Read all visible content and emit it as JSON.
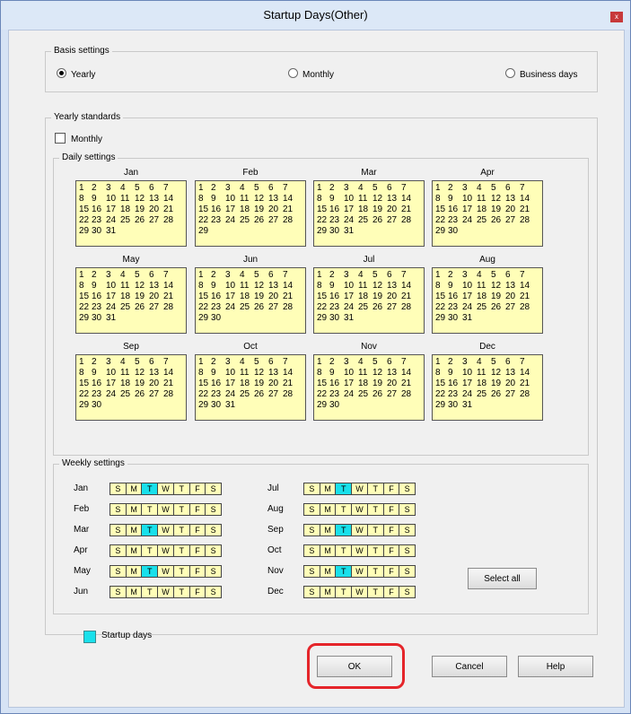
{
  "window": {
    "title": "Startup Days(Other)",
    "close_glyph": "x"
  },
  "basis": {
    "label": "Basis settings",
    "options": [
      {
        "label": "Yearly",
        "selected": true
      },
      {
        "label": "Monthly",
        "selected": false
      },
      {
        "label": "Business days",
        "selected": false
      }
    ]
  },
  "yearly": {
    "label": "Yearly standards",
    "monthly_checkbox": "Monthly",
    "daily_label": "Daily settings",
    "months": [
      {
        "name": "Jan",
        "rows": [
          [
            "1",
            "2",
            "3",
            "4",
            "5",
            "6",
            "7"
          ],
          [
            "8",
            "9",
            "10",
            "11",
            "12",
            "13",
            "14"
          ],
          [
            "15",
            "16",
            "17",
            "18",
            "19",
            "20",
            "21"
          ],
          [
            "22",
            "23",
            "24",
            "25",
            "26",
            "27",
            "28"
          ],
          [
            "29",
            "30",
            "31"
          ]
        ]
      },
      {
        "name": "Feb",
        "rows": [
          [
            "1",
            "2",
            "3",
            "4",
            "5",
            "6",
            "7"
          ],
          [
            "8",
            "9",
            "10",
            "11",
            "12",
            "13",
            "14"
          ],
          [
            "15",
            "16",
            "17",
            "18",
            "19",
            "20",
            "21"
          ],
          [
            "22",
            "23",
            "24",
            "25",
            "26",
            "27",
            "28"
          ],
          [
            "29"
          ]
        ]
      },
      {
        "name": "Mar",
        "rows": [
          [
            "1",
            "2",
            "3",
            "4",
            "5",
            "6",
            "7"
          ],
          [
            "8",
            "9",
            "10",
            "11",
            "12",
            "13",
            "14"
          ],
          [
            "15",
            "16",
            "17",
            "18",
            "19",
            "20",
            "21"
          ],
          [
            "22",
            "23",
            "24",
            "25",
            "26",
            "27",
            "28"
          ],
          [
            "29",
            "30",
            "31"
          ]
        ]
      },
      {
        "name": "Apr",
        "rows": [
          [
            "1",
            "2",
            "3",
            "4",
            "5",
            "6",
            "7"
          ],
          [
            "8",
            "9",
            "10",
            "11",
            "12",
            "13",
            "14"
          ],
          [
            "15",
            "16",
            "17",
            "18",
            "19",
            "20",
            "21"
          ],
          [
            "22",
            "23",
            "24",
            "25",
            "26",
            "27",
            "28"
          ],
          [
            "29",
            "30"
          ]
        ]
      },
      {
        "name": "May",
        "rows": [
          [
            "1",
            "2",
            "3",
            "4",
            "5",
            "6",
            "7"
          ],
          [
            "8",
            "9",
            "10",
            "11",
            "12",
            "13",
            "14"
          ],
          [
            "15",
            "16",
            "17",
            "18",
            "19",
            "20",
            "21"
          ],
          [
            "22",
            "23",
            "24",
            "25",
            "26",
            "27",
            "28"
          ],
          [
            "29",
            "30",
            "31"
          ]
        ]
      },
      {
        "name": "Jun",
        "rows": [
          [
            "1",
            "2",
            "3",
            "4",
            "5",
            "6",
            "7"
          ],
          [
            "8",
            "9",
            "10",
            "11",
            "12",
            "13",
            "14"
          ],
          [
            "15",
            "16",
            "17",
            "18",
            "19",
            "20",
            "21"
          ],
          [
            "22",
            "23",
            "24",
            "25",
            "26",
            "27",
            "28"
          ],
          [
            "29",
            "30"
          ]
        ]
      },
      {
        "name": "Jul",
        "rows": [
          [
            "1",
            "2",
            "3",
            "4",
            "5",
            "6",
            "7"
          ],
          [
            "8",
            "9",
            "10",
            "11",
            "12",
            "13",
            "14"
          ],
          [
            "15",
            "16",
            "17",
            "18",
            "19",
            "20",
            "21"
          ],
          [
            "22",
            "23",
            "24",
            "25",
            "26",
            "27",
            "28"
          ],
          [
            "29",
            "30",
            "31"
          ]
        ]
      },
      {
        "name": "Aug",
        "rows": [
          [
            "1",
            "2",
            "3",
            "4",
            "5",
            "6",
            "7"
          ],
          [
            "8",
            "9",
            "10",
            "11",
            "12",
            "13",
            "14"
          ],
          [
            "15",
            "16",
            "17",
            "18",
            "19",
            "20",
            "21"
          ],
          [
            "22",
            "23",
            "24",
            "25",
            "26",
            "27",
            "28"
          ],
          [
            "29",
            "30",
            "31"
          ]
        ]
      },
      {
        "name": "Sep",
        "rows": [
          [
            "1",
            "2",
            "3",
            "4",
            "5",
            "6",
            "7"
          ],
          [
            "8",
            "9",
            "10",
            "11",
            "12",
            "13",
            "14"
          ],
          [
            "15",
            "16",
            "17",
            "18",
            "19",
            "20",
            "21"
          ],
          [
            "22",
            "23",
            "24",
            "25",
            "26",
            "27",
            "28"
          ],
          [
            "29",
            "30"
          ]
        ]
      },
      {
        "name": "Oct",
        "rows": [
          [
            "1",
            "2",
            "3",
            "4",
            "5",
            "6",
            "7"
          ],
          [
            "8",
            "9",
            "10",
            "11",
            "12",
            "13",
            "14"
          ],
          [
            "15",
            "16",
            "17",
            "18",
            "19",
            "20",
            "21"
          ],
          [
            "22",
            "23",
            "24",
            "25",
            "26",
            "27",
            "28"
          ],
          [
            "29",
            "30",
            "31"
          ]
        ]
      },
      {
        "name": "Nov",
        "rows": [
          [
            "1",
            "2",
            "3",
            "4",
            "5",
            "6",
            "7"
          ],
          [
            "8",
            "9",
            "10",
            "11",
            "12",
            "13",
            "14"
          ],
          [
            "15",
            "16",
            "17",
            "18",
            "19",
            "20",
            "21"
          ],
          [
            "22",
            "23",
            "24",
            "25",
            "26",
            "27",
            "28"
          ],
          [
            "29",
            "30"
          ]
        ]
      },
      {
        "name": "Dec",
        "rows": [
          [
            "1",
            "2",
            "3",
            "4",
            "5",
            "6",
            "7"
          ],
          [
            "8",
            "9",
            "10",
            "11",
            "12",
            "13",
            "14"
          ],
          [
            "15",
            "16",
            "17",
            "18",
            "19",
            "20",
            "21"
          ],
          [
            "22",
            "23",
            "24",
            "25",
            "26",
            "27",
            "28"
          ],
          [
            "29",
            "30",
            "31"
          ]
        ]
      }
    ]
  },
  "weekly": {
    "label": "Weekly settings",
    "day_letters": [
      "S",
      "M",
      "T",
      "W",
      "T",
      "F",
      "S"
    ],
    "months": [
      {
        "name": "Jan",
        "on": [
          2
        ]
      },
      {
        "name": "Feb",
        "on": []
      },
      {
        "name": "Mar",
        "on": [
          2
        ]
      },
      {
        "name": "Apr",
        "on": []
      },
      {
        "name": "May",
        "on": [
          2
        ]
      },
      {
        "name": "Jun",
        "on": []
      },
      {
        "name": "Jul",
        "on": [
          2
        ]
      },
      {
        "name": "Aug",
        "on": []
      },
      {
        "name": "Sep",
        "on": [
          2
        ]
      },
      {
        "name": "Oct",
        "on": []
      },
      {
        "name": "Nov",
        "on": [
          2
        ]
      },
      {
        "name": "Dec",
        "on": []
      }
    ],
    "select_all": "Select all"
  },
  "legend": {
    "label": "Startup days",
    "color": "#19e0eb"
  },
  "buttons": {
    "ok": "OK",
    "cancel": "Cancel",
    "help": "Help"
  },
  "colors": {
    "calendar_bg": "#fffeb8",
    "highlight": "#e5252a"
  }
}
